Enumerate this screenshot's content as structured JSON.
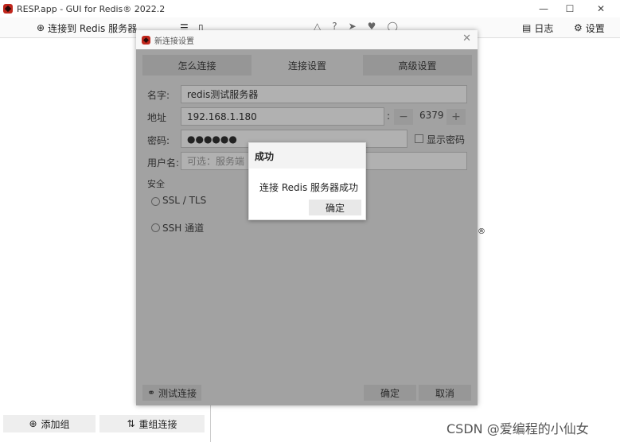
{
  "app": {
    "title": "RESP.app - GUI for Redis® 2022.2",
    "min_icon": "—",
    "max_icon": "☐",
    "close_icon": "✕"
  },
  "toolbar": {
    "connect_label": "连接到 Redis 服务器",
    "log_label": "日志",
    "settings_label": "设置"
  },
  "sidebar": {
    "add_group_label": "添加组",
    "reorder_label": "重组连接"
  },
  "dialog": {
    "title": "新连接设置",
    "tabs": [
      {
        "label": "怎么连接"
      },
      {
        "label": "连接设置"
      },
      {
        "label": "高级设置"
      }
    ],
    "name_label": "名字:",
    "name_value": "redis测试服务器",
    "address_label": "地址",
    "host_value": "192.168.1.180",
    "port_value": "6379",
    "password_label": "密码:",
    "password_value": "●●●●●●",
    "show_password_label": "显示密码",
    "username_label": "用户名:",
    "username_placeholder": "可选：服务端",
    "security_label": "安全",
    "ssl_label": "SSL / TLS",
    "ssh_label": "SSH 通道",
    "test_button": "测试连接",
    "ok_button": "确定",
    "cancel_button": "取消"
  },
  "message": {
    "title": "成功",
    "text": "连接 Redis 服务器成功",
    "ok_label": "确定"
  },
  "watermark": "CSDN @爱编程的小仙女"
}
